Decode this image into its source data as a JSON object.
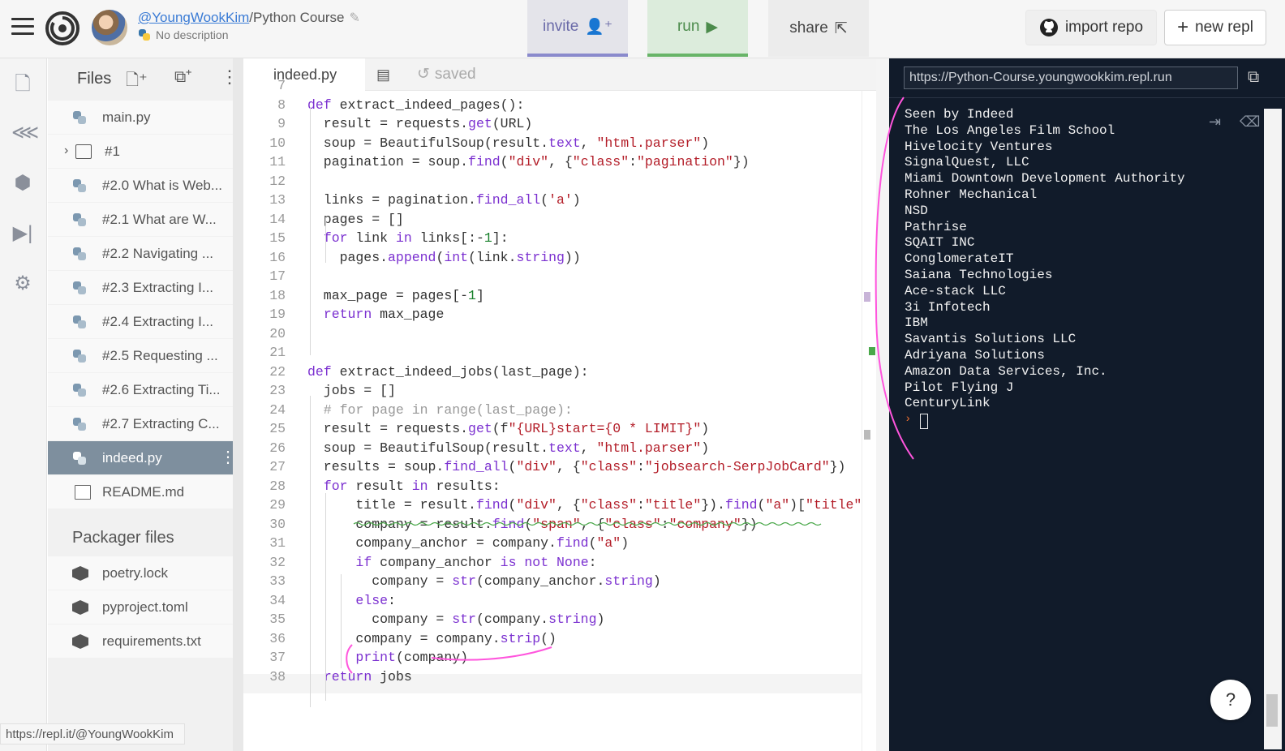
{
  "header": {
    "owner": "@YoungWookKim",
    "repl_name": "/Python Course",
    "description": "No description",
    "invite_label": "invite",
    "run_label": "run",
    "share_label": "share",
    "import_label": "import repo",
    "new_label": "new repl"
  },
  "rail_icons": [
    "files-icon",
    "share-network-icon",
    "packages-icon",
    "debugger-icon",
    "settings-icon"
  ],
  "files_panel": {
    "title": "Files",
    "items": [
      {
        "label": "main.py",
        "icon": "python"
      },
      {
        "label": "#1",
        "icon": "folder"
      },
      {
        "label": "#2.0 What is Web...",
        "icon": "python"
      },
      {
        "label": "#2.1 What are W...",
        "icon": "python"
      },
      {
        "label": "#2.2 Navigating ...",
        "icon": "python"
      },
      {
        "label": "#2.3 Extracting I...",
        "icon": "python"
      },
      {
        "label": "#2.4 Extracting I...",
        "icon": "python"
      },
      {
        "label": "#2.5 Requesting ...",
        "icon": "python"
      },
      {
        "label": "#2.6 Extracting Ti...",
        "icon": "python"
      },
      {
        "label": "#2.7 Extracting C...",
        "icon": "python"
      },
      {
        "label": "indeed.py",
        "icon": "python",
        "active": true
      },
      {
        "label": "README.md",
        "icon": "doc"
      }
    ],
    "packager_title": "Packager files",
    "packager_items": [
      "poetry.lock",
      "pyproject.toml",
      "requirements.txt"
    ]
  },
  "editor": {
    "tab": "indeed.py",
    "saved_label": "saved",
    "lines": [
      {
        "n": "7",
        "code": ""
      },
      {
        "n": "8",
        "code": "def extract_indeed_pages():"
      },
      {
        "n": "9",
        "code": "  result = requests.get(URL)"
      },
      {
        "n": "10",
        "code": "  soup = BeautifulSoup(result.text, \"html.parser\")"
      },
      {
        "n": "11",
        "code": "  pagination = soup.find(\"div\", {\"class\":\"pagination\"})"
      },
      {
        "n": "12",
        "code": ""
      },
      {
        "n": "13",
        "code": "  links = pagination.find_all('a')"
      },
      {
        "n": "14",
        "code": "  pages = []"
      },
      {
        "n": "15",
        "code": "  for link in links[:-1]:"
      },
      {
        "n": "16",
        "code": "    pages.append(int(link.string))"
      },
      {
        "n": "17",
        "code": ""
      },
      {
        "n": "18",
        "code": "  max_page = pages[-1]"
      },
      {
        "n": "19",
        "code": "  return max_page"
      },
      {
        "n": "20",
        "code": ""
      },
      {
        "n": "21",
        "code": ""
      },
      {
        "n": "22",
        "code": "def extract_indeed_jobs(last_page):"
      },
      {
        "n": "23",
        "code": "  jobs = []"
      },
      {
        "n": "24",
        "code": "  # for page in range(last_page):"
      },
      {
        "n": "25",
        "code": "  result = requests.get(f\"{URL}start={0 * LIMIT}\")"
      },
      {
        "n": "26",
        "code": "  soup = BeautifulSoup(result.text, \"html.parser\")"
      },
      {
        "n": "27",
        "code": "  results = soup.find_all(\"div\", {\"class\":\"jobsearch-SerpJobCard\"})"
      },
      {
        "n": "28",
        "code": "  for result in results:"
      },
      {
        "n": "29",
        "code": "      title = result.find(\"div\", {\"class\":\"title\"}).find(\"a\")[\"title\"]"
      },
      {
        "n": "30",
        "code": "      company = result.find(\"span\", {\"class\":\"company\"})"
      },
      {
        "n": "31",
        "code": "      company_anchor = company.find(\"a\")"
      },
      {
        "n": "32",
        "code": "      if company_anchor is not None:"
      },
      {
        "n": "33",
        "code": "        company = str(company_anchor.string)"
      },
      {
        "n": "34",
        "code": "      else:"
      },
      {
        "n": "35",
        "code": "        company = str(company.string)"
      },
      {
        "n": "36",
        "code": "      company = company.strip()"
      },
      {
        "n": "37",
        "code": "      print(company)"
      },
      {
        "n": "38",
        "code": "  return jobs"
      }
    ]
  },
  "console": {
    "url": "https://Python-Course.youngwookkim.repl.run",
    "output": [
      "Seen by Indeed",
      "The Los Angeles Film School",
      "Hivelocity Ventures",
      "SignalQuest, LLC",
      "Miami Downtown Development Authority",
      "Rohner Mechanical",
      "NSD",
      "Pathrise",
      "SQAIT INC",
      "ConglomerateIT",
      "Saiana Technologies",
      "Ace-stack LLC",
      "3i Infotech",
      "IBM",
      "Savantis Solutions LLC",
      "Adriyana Solutions",
      "Amazon Data Services, Inc.",
      "Pilot Flying J",
      "CenturyLink"
    ],
    "prompt": "›",
    "help": "?"
  },
  "status_url": "https://repl.it/@YoungWookKim",
  "colors": {
    "accent": "#3a7bd5",
    "console_bg": "#111b2a",
    "active_file": "#7e8f9e",
    "annotation": "#ff55dd"
  }
}
